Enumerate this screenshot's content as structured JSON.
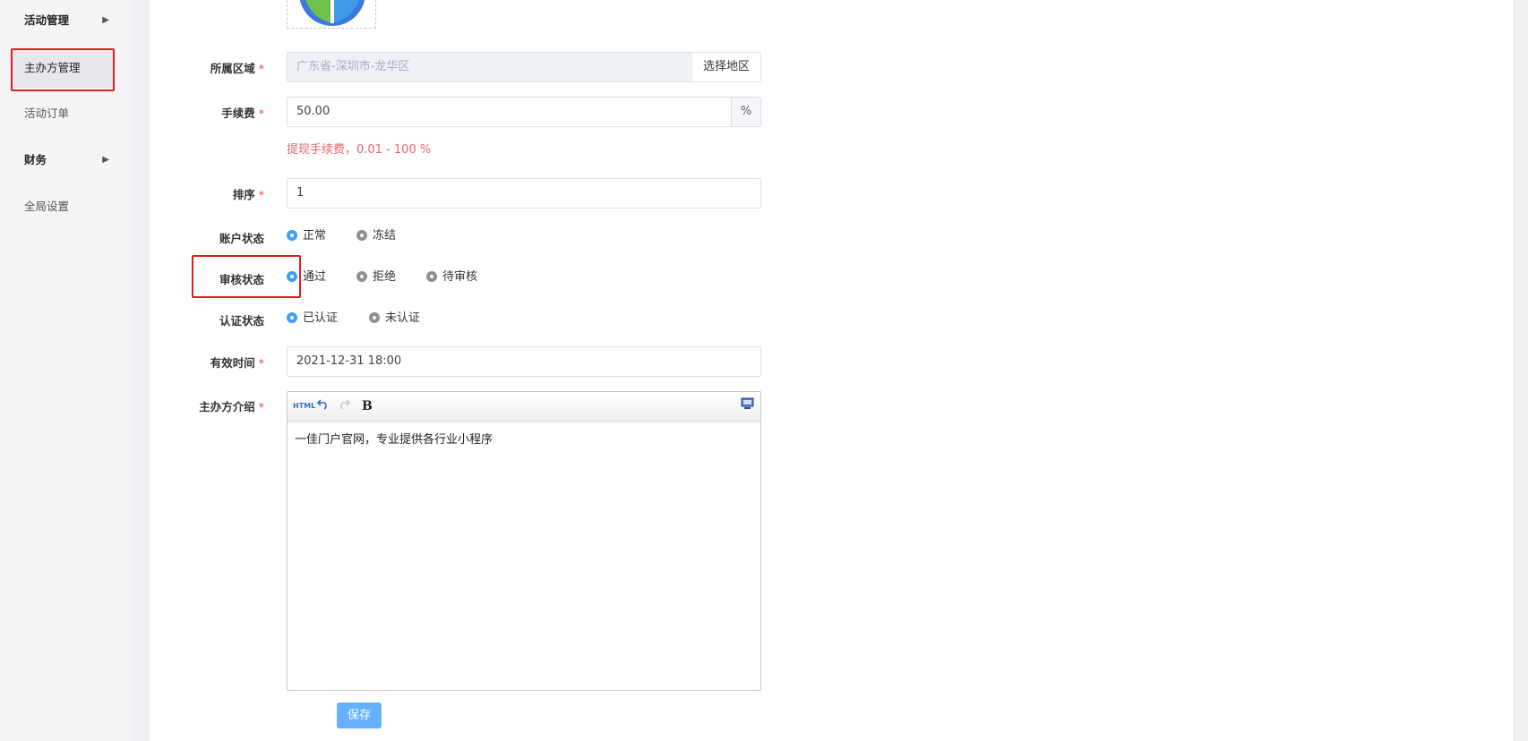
{
  "sidebar": {
    "items": [
      {
        "label": "活动管理",
        "arrow": "▶"
      },
      {
        "label": "主办方管理"
      },
      {
        "label": "活动订单"
      },
      {
        "label": "财务",
        "arrow": "▶"
      },
      {
        "label": "全局设置"
      }
    ]
  },
  "form": {
    "region": {
      "label": "所属区域",
      "required": "*",
      "placeholder": "广东省-深圳市-龙华区",
      "button": "选择地区"
    },
    "fee": {
      "label": "手续费",
      "required": "*",
      "value": "50.00",
      "suffix": "%",
      "hint": "提现手续费，0.01 - 100 %"
    },
    "sort": {
      "label": "排序",
      "required": "*",
      "value": "1"
    },
    "account_status": {
      "label": "账户状态",
      "options": [
        "正常",
        "冻结"
      ],
      "selected": "正常"
    },
    "review_status": {
      "label": "审核状态",
      "options": [
        "通过",
        "拒绝",
        "待审核"
      ],
      "selected": "通过"
    },
    "cert_status": {
      "label": "认证状态",
      "options": [
        "已认证",
        "未认证"
      ],
      "selected": "已认证"
    },
    "valid_time": {
      "label": "有效时间",
      "required": "*",
      "value": "2021-12-31 18:00"
    },
    "intro": {
      "label": "主办方介绍",
      "required": "*",
      "toolbar": {
        "html": "HTML",
        "bold": "B"
      },
      "content": "一佳门户官网，专业提供各行业小程序"
    },
    "save_label": "保存"
  },
  "colors": {
    "accent": "#409eff",
    "highlight": "#e02020",
    "hint": "#e9636b"
  }
}
